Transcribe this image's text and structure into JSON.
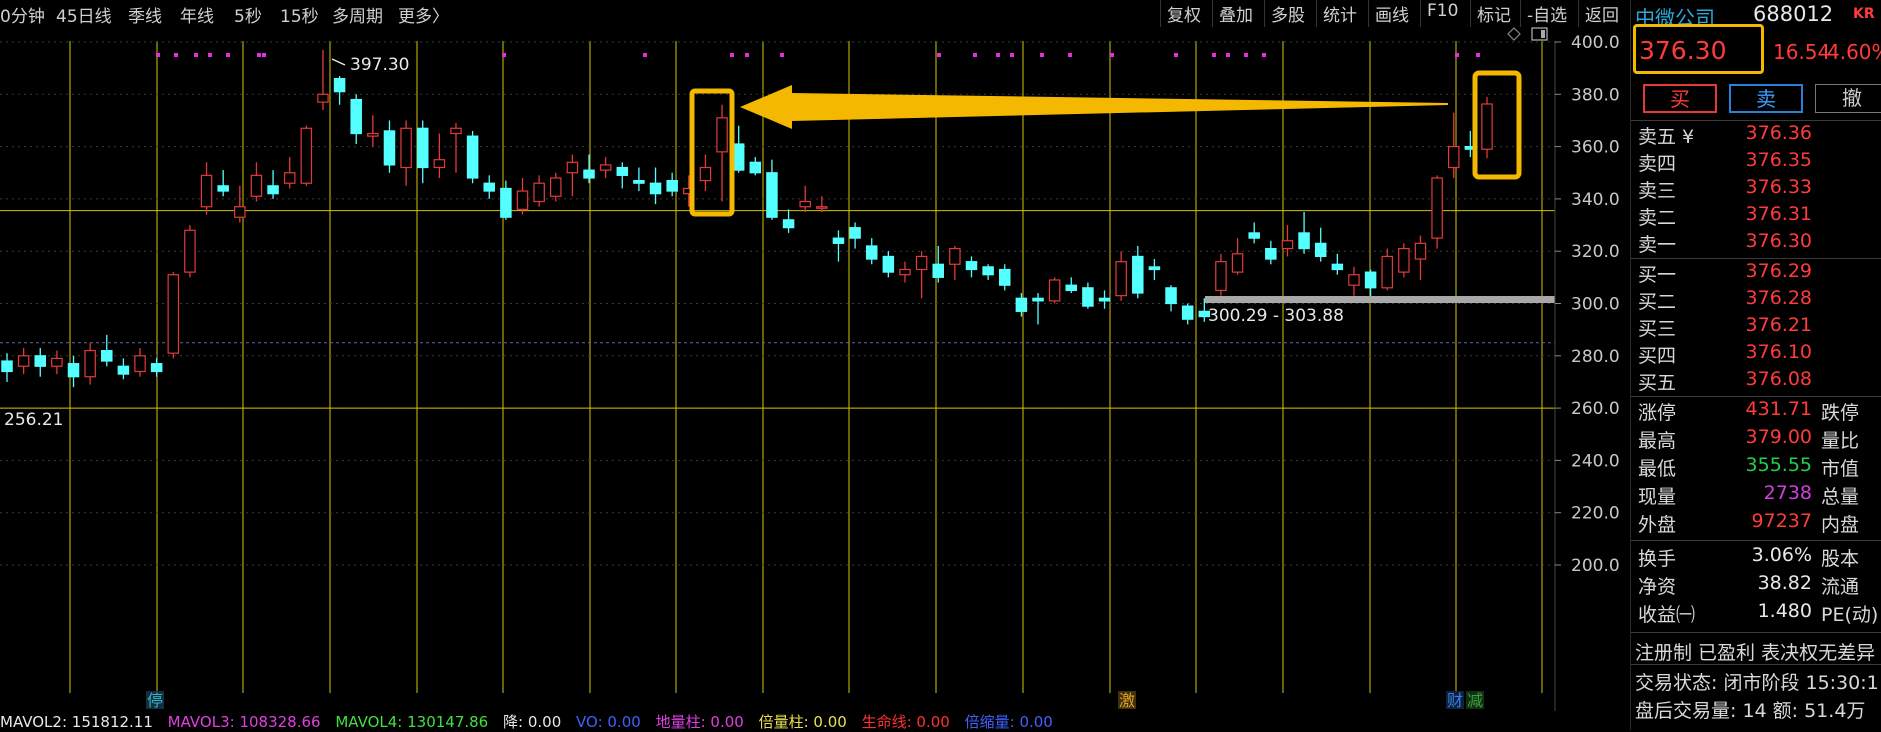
{
  "toolbar": {
    "periods": [
      "0分钟",
      "45日线",
      "季线",
      "年线",
      "5秒",
      "15秒",
      "多周期",
      "更多〉"
    ],
    "actions": [
      "复权",
      "叠加",
      "多股",
      "统计",
      "画线",
      "F10",
      "标记",
      "-自选",
      "返回"
    ]
  },
  "chart": {
    "y_ticks": [
      "400.0",
      "380.0",
      "360.0",
      "340.0",
      "320.0",
      "300.0",
      "280.0",
      "260.0",
      "240.0",
      "220.0",
      "200.0"
    ],
    "high_label": "397.30",
    "low_label": "256.21",
    "range_label": "300.29 - 303.88",
    "markers": [
      {
        "text": "停",
        "color": "#3ab0c0"
      },
      {
        "text": "激",
        "color": "#e0a020"
      },
      {
        "text": "财",
        "color": "#3a7fe0"
      },
      {
        "text": "减",
        "color": "#3aa040"
      }
    ],
    "colors": {
      "up": "#e23a3a",
      "down": "#54ffff",
      "grid": "#d4c30a",
      "highlight": "#f5b800"
    }
  },
  "chart_data": {
    "type": "candlestick",
    "ylim": [
      200,
      400
    ],
    "candles": [
      {
        "o": 278,
        "c": 274,
        "h": 281,
        "l": 270
      },
      {
        "o": 276,
        "c": 280,
        "h": 283,
        "l": 273
      },
      {
        "o": 280,
        "c": 276,
        "h": 283,
        "l": 272
      },
      {
        "o": 276,
        "c": 279,
        "h": 282,
        "l": 273
      },
      {
        "o": 277,
        "c": 272,
        "h": 280,
        "l": 268
      },
      {
        "o": 272,
        "c": 282,
        "h": 285,
        "l": 269
      },
      {
        "o": 282,
        "c": 278,
        "h": 288,
        "l": 276
      },
      {
        "o": 276,
        "c": 273,
        "h": 279,
        "l": 271
      },
      {
        "o": 274,
        "c": 280,
        "h": 283,
        "l": 272
      },
      {
        "o": 277,
        "c": 274,
        "h": 279,
        "l": 272
      },
      {
        "o": 281,
        "c": 311,
        "h": 312,
        "l": 279
      },
      {
        "o": 312,
        "c": 328,
        "h": 330,
        "l": 310
      },
      {
        "o": 337,
        "c": 349,
        "h": 354,
        "l": 334
      },
      {
        "o": 345,
        "c": 343,
        "h": 351,
        "l": 341
      },
      {
        "o": 333,
        "c": 337,
        "h": 345,
        "l": 331
      },
      {
        "o": 341,
        "c": 349,
        "h": 354,
        "l": 339
      },
      {
        "o": 345,
        "c": 342,
        "h": 351,
        "l": 340
      },
      {
        "o": 346,
        "c": 350,
        "h": 356,
        "l": 344
      },
      {
        "o": 346,
        "c": 367,
        "h": 368,
        "l": 345
      },
      {
        "o": 377,
        "c": 380,
        "h": 397,
        "l": 374
      },
      {
        "o": 386,
        "c": 381,
        "h": 387,
        "l": 376
      },
      {
        "o": 378,
        "c": 365,
        "h": 380,
        "l": 361
      },
      {
        "o": 364,
        "c": 365,
        "h": 372,
        "l": 360
      },
      {
        "o": 366,
        "c": 353,
        "h": 370,
        "l": 350
      },
      {
        "o": 352,
        "c": 367,
        "h": 370,
        "l": 345
      },
      {
        "o": 367,
        "c": 352,
        "h": 370,
        "l": 346
      },
      {
        "o": 352,
        "c": 355,
        "h": 365,
        "l": 348
      },
      {
        "o": 365,
        "c": 367,
        "h": 369,
        "l": 350
      },
      {
        "o": 364,
        "c": 348,
        "h": 366,
        "l": 346
      },
      {
        "o": 346,
        "c": 343,
        "h": 349,
        "l": 340
      },
      {
        "o": 344,
        "c": 333,
        "h": 347,
        "l": 332
      },
      {
        "o": 336,
        "c": 343,
        "h": 348,
        "l": 334
      },
      {
        "o": 339,
        "c": 346,
        "h": 349,
        "l": 337
      },
      {
        "o": 341,
        "c": 348,
        "h": 350,
        "l": 339
      },
      {
        "o": 350,
        "c": 354,
        "h": 357,
        "l": 341
      },
      {
        "o": 351,
        "c": 348,
        "h": 357,
        "l": 346
      },
      {
        "o": 351,
        "c": 353,
        "h": 356,
        "l": 348
      },
      {
        "o": 352,
        "c": 349,
        "h": 354,
        "l": 344
      },
      {
        "o": 347,
        "c": 346,
        "h": 352,
        "l": 343
      },
      {
        "o": 346,
        "c": 342,
        "h": 352,
        "l": 338
      },
      {
        "o": 347,
        "c": 343,
        "h": 350,
        "l": 341
      },
      {
        "o": 342,
        "c": 344,
        "h": 349,
        "l": 337
      },
      {
        "o": 347,
        "c": 352,
        "h": 357,
        "l": 343
      },
      {
        "o": 358,
        "c": 371,
        "h": 376,
        "l": 339
      },
      {
        "o": 361,
        "c": 351,
        "h": 368,
        "l": 350
      },
      {
        "o": 354,
        "c": 350,
        "h": 356,
        "l": 349
      },
      {
        "o": 350,
        "c": 333,
        "h": 355,
        "l": 332
      },
      {
        "o": 332,
        "c": 329,
        "h": 336,
        "l": 327
      },
      {
        "o": 337,
        "c": 339,
        "h": 345,
        "l": 335
      },
      {
        "o": 337,
        "c": 337,
        "h": 341,
        "l": 335
      },
      {
        "o": 325,
        "c": 323,
        "h": 328,
        "l": 316
      },
      {
        "o": 329,
        "c": 325,
        "h": 331,
        "l": 321
      },
      {
        "o": 322,
        "c": 317,
        "h": 325,
        "l": 315
      },
      {
        "o": 318,
        "c": 312,
        "h": 320,
        "l": 310
      },
      {
        "o": 311,
        "c": 313,
        "h": 316,
        "l": 308
      },
      {
        "o": 313,
        "c": 318,
        "h": 320,
        "l": 302
      },
      {
        "o": 315,
        "c": 310,
        "h": 322,
        "l": 308
      },
      {
        "o": 315,
        "c": 321,
        "h": 322,
        "l": 309
      },
      {
        "o": 316,
        "c": 313,
        "h": 318,
        "l": 310
      },
      {
        "o": 314,
        "c": 311,
        "h": 315,
        "l": 309
      },
      {
        "o": 313,
        "c": 307,
        "h": 315,
        "l": 305
      },
      {
        "o": 302,
        "c": 297,
        "h": 304,
        "l": 295
      },
      {
        "o": 302,
        "c": 301,
        "h": 304,
        "l": 292
      },
      {
        "o": 301,
        "c": 309,
        "h": 310,
        "l": 300
      },
      {
        "o": 307,
        "c": 305,
        "h": 310,
        "l": 304
      },
      {
        "o": 306,
        "c": 299,
        "h": 308,
        "l": 298
      },
      {
        "o": 302,
        "c": 301,
        "h": 305,
        "l": 298
      },
      {
        "o": 303,
        "c": 316,
        "h": 320,
        "l": 301
      },
      {
        "o": 318,
        "c": 304,
        "h": 322,
        "l": 302
      },
      {
        "o": 314,
        "c": 313,
        "h": 317,
        "l": 309
      },
      {
        "o": 306,
        "c": 300,
        "h": 307,
        "l": 297
      },
      {
        "o": 299,
        "c": 294,
        "h": 300,
        "l": 292
      },
      {
        "o": 297,
        "c": 295,
        "h": 302,
        "l": 293
      },
      {
        "o": 305,
        "c": 316,
        "h": 319,
        "l": 303
      },
      {
        "o": 312,
        "c": 319,
        "h": 325,
        "l": 311
      },
      {
        "o": 327,
        "c": 325,
        "h": 331,
        "l": 323
      },
      {
        "o": 321,
        "c": 317,
        "h": 324,
        "l": 315
      },
      {
        "o": 321,
        "c": 324,
        "h": 330,
        "l": 318
      },
      {
        "o": 327,
        "c": 321,
        "h": 335,
        "l": 319
      },
      {
        "o": 323,
        "c": 318,
        "h": 329,
        "l": 316
      },
      {
        "o": 315,
        "c": 313,
        "h": 319,
        "l": 311
      },
      {
        "o": 307,
        "c": 311,
        "h": 314,
        "l": 303
      },
      {
        "o": 312,
        "c": 306,
        "h": 313,
        "l": 302
      },
      {
        "o": 306,
        "c": 318,
        "h": 321,
        "l": 305
      },
      {
        "o": 312,
        "c": 321,
        "h": 323,
        "l": 310
      },
      {
        "o": 317,
        "c": 323,
        "h": 326,
        "l": 309
      },
      {
        "o": 325,
        "c": 348,
        "h": 349,
        "l": 321
      },
      {
        "o": 352,
        "c": 360,
        "h": 373,
        "l": 348
      },
      {
        "o": 360,
        "c": 359,
        "h": 366,
        "l": 356
      },
      {
        "o": 359,
        "c": 376.3,
        "h": 379,
        "l": 355.55
      }
    ]
  },
  "bottom": {
    "items": [
      {
        "text": "MAVOL2: 151812.11",
        "color": "#e8e8e8"
      },
      {
        "text": "MAVOL3: 108328.66",
        "color": "#e040e0"
      },
      {
        "text": "MAVOL4: 130147.86",
        "color": "#40e040"
      },
      {
        "text": "降: 0.00",
        "color": "#e8e8e8"
      },
      {
        "text": "VO: 0.00",
        "color": "#4060ff"
      },
      {
        "text": "地量柱: 0.00",
        "color": "#e040e0"
      },
      {
        "text": "倍量柱: 0.00",
        "color": "#e8e050"
      },
      {
        "text": "生命线: 0.00",
        "color": "#ff3030"
      },
      {
        "text": "倍缩量: 0.00",
        "color": "#4060ff"
      }
    ]
  },
  "panel": {
    "name": "中微公司",
    "code": "688012",
    "badge": "KR",
    "price": "376.30",
    "change": "16.54",
    "change_pct": "4.60%",
    "buy_label": "买",
    "sell_label": "卖",
    "cancel_label": "撤",
    "asks": [
      {
        "label": "卖五 ¥",
        "price": "376.36"
      },
      {
        "label": "卖四",
        "price": "376.35"
      },
      {
        "label": "卖三",
        "price": "376.33"
      },
      {
        "label": "卖二",
        "price": "376.31"
      },
      {
        "label": "卖一",
        "price": "376.30"
      }
    ],
    "bids": [
      {
        "label": "买一",
        "price": "376.29"
      },
      {
        "label": "买二",
        "price": "376.28"
      },
      {
        "label": "买三",
        "price": "376.21"
      },
      {
        "label": "买四",
        "price": "376.10"
      },
      {
        "label": "买五",
        "price": "376.08"
      }
    ],
    "stats": [
      {
        "label": "涨停",
        "value": "431.71",
        "color": "#ff3b3b",
        "label2": "跌停"
      },
      {
        "label": "最高",
        "value": "379.00",
        "color": "#ff3b3b",
        "label2": "量比"
      },
      {
        "label": "最低",
        "value": "355.55",
        "color": "#22d04a",
        "label2": "市值"
      },
      {
        "label": "现量",
        "value": "2738",
        "color": "#d040e0",
        "label2": "总量"
      },
      {
        "label": "外盘",
        "value": "97237",
        "color": "#ff3b3b",
        "label2": "内盘"
      }
    ],
    "fundamentals": [
      {
        "label": "换手",
        "value": "3.06%",
        "label2": "股本"
      },
      {
        "label": "净资",
        "value": "38.82",
        "label2": "流通"
      },
      {
        "label": "收益㈠",
        "value": "1.480",
        "label2": "PE(动)"
      }
    ],
    "registration": "注册制 已盈利 表决权无差异",
    "trade_status": "交易状态: 闭市阶段 15:30:1",
    "after_hours": "盘后交易量: 14  额: 51.4万"
  }
}
